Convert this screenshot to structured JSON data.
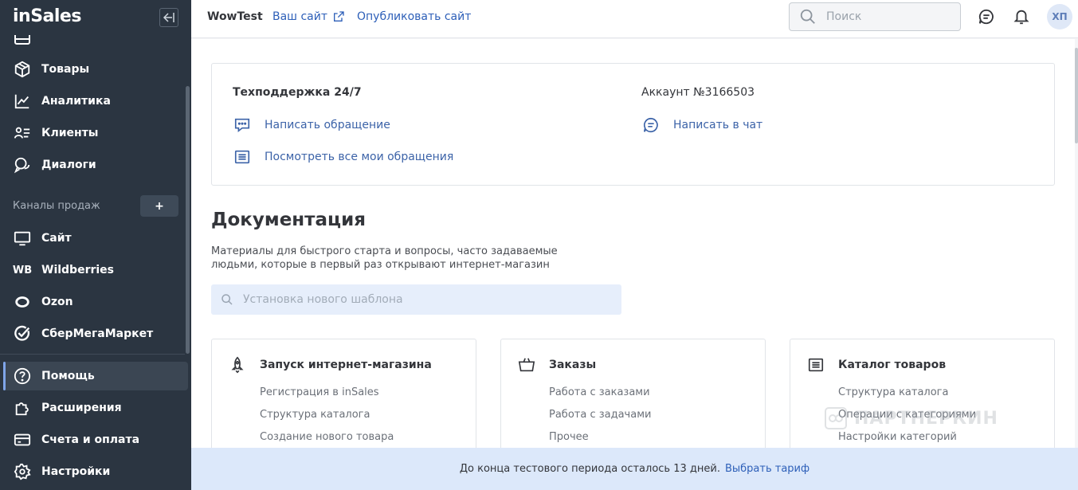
{
  "sidebar": {
    "logo": "inSales",
    "items": [
      {
        "label": "Товары"
      },
      {
        "label": "Аналитика"
      },
      {
        "label": "Клиенты"
      },
      {
        "label": "Диалоги"
      }
    ],
    "channels_label": "Каналы продаж",
    "channels_add": "+",
    "channels": [
      {
        "label": "Сайт"
      },
      {
        "label": "Wildberries",
        "badge": "WB"
      },
      {
        "label": "Ozon"
      },
      {
        "label": "СберМегаМаркет"
      }
    ],
    "bottom_items": [
      {
        "label": "Помощь",
        "active": true
      },
      {
        "label": "Расширения"
      },
      {
        "label": "Счета и оплата"
      },
      {
        "label": "Настройки"
      }
    ]
  },
  "topbar": {
    "store_name": "WowTest",
    "your_site": "Ваш сайт",
    "publish_site": "Опубликовать сайт",
    "search_placeholder": "Поиск",
    "avatar": "ХП"
  },
  "support": {
    "title": "Техподдержка 24/7",
    "account": "Аккаунт №3166503",
    "write_ticket": "Написать обращение",
    "view_tickets": "Посмотреть все мои обращения",
    "write_chat": "Написать в чат"
  },
  "docs": {
    "title": "Документация",
    "description": "Материалы для быстрого старта и вопросы, часто задаваемые людьми, которые в первый раз открывают интернет-магазин",
    "search_placeholder": "Установка нового шаблона",
    "categories": [
      {
        "title": "Запуск интернет-магазина",
        "icon": "rocket-icon",
        "links": [
          "Регистрация в inSales",
          "Структура каталога",
          "Создание нового товара"
        ]
      },
      {
        "title": "Заказы",
        "icon": "basket-icon",
        "links": [
          "Работа с заказами",
          "Работа с задачами",
          "Прочее"
        ]
      },
      {
        "title": "Каталог товаров",
        "icon": "list-icon",
        "links": [
          "Структура каталога",
          "Операции с категориями",
          "Настройки категорий"
        ]
      }
    ]
  },
  "banner": {
    "text": "До конца тестового периода осталось 13 дней.",
    "link": "Выбрать тариф"
  },
  "watermark": "ПАРТНЕРКИН"
}
